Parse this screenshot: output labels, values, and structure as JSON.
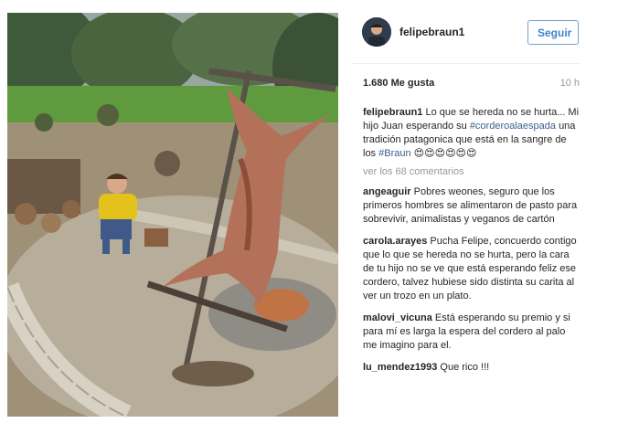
{
  "post": {
    "username": "felipebraun1",
    "follow_label": "Seguir",
    "likes": "1.680 Me gusta",
    "time": "10 h"
  },
  "caption": {
    "user": "felipebraun1",
    "text_1": "Lo que se hereda no se hurta... Mi hijo Juan esperando su",
    "hashtag_1": "#corderoalaespada",
    "text_2": "una tradición patagonica que está en la sangre de los",
    "hashtag_2": "#Braun",
    "emojis": "😍😍😍😍😍😍"
  },
  "view_all_comments": "ver los 68 comentarios",
  "comments": [
    {
      "user": "angeaguir",
      "text": "Pobres weones, seguro que los primeros hombres se alimentaron de pasto para sobrevivir, animalistas y veganos de cartón"
    },
    {
      "user": "carola.arayes",
      "text": "Pucha Felipe, concuerdo contigo que lo que se hereda no se hurta, pero la cara de tu hijo no se ve que está esperando feliz ese cordero, talvez hubiese sido distinta su carita al ver un trozo en un plato."
    },
    {
      "user": "malovi_vicuna",
      "text": "Está esperando su premio y si para mí es larga la espera del cordero al palo me imagino para el."
    },
    {
      "user": "lu_mendez1993",
      "text": "Que rico !!!"
    }
  ]
}
